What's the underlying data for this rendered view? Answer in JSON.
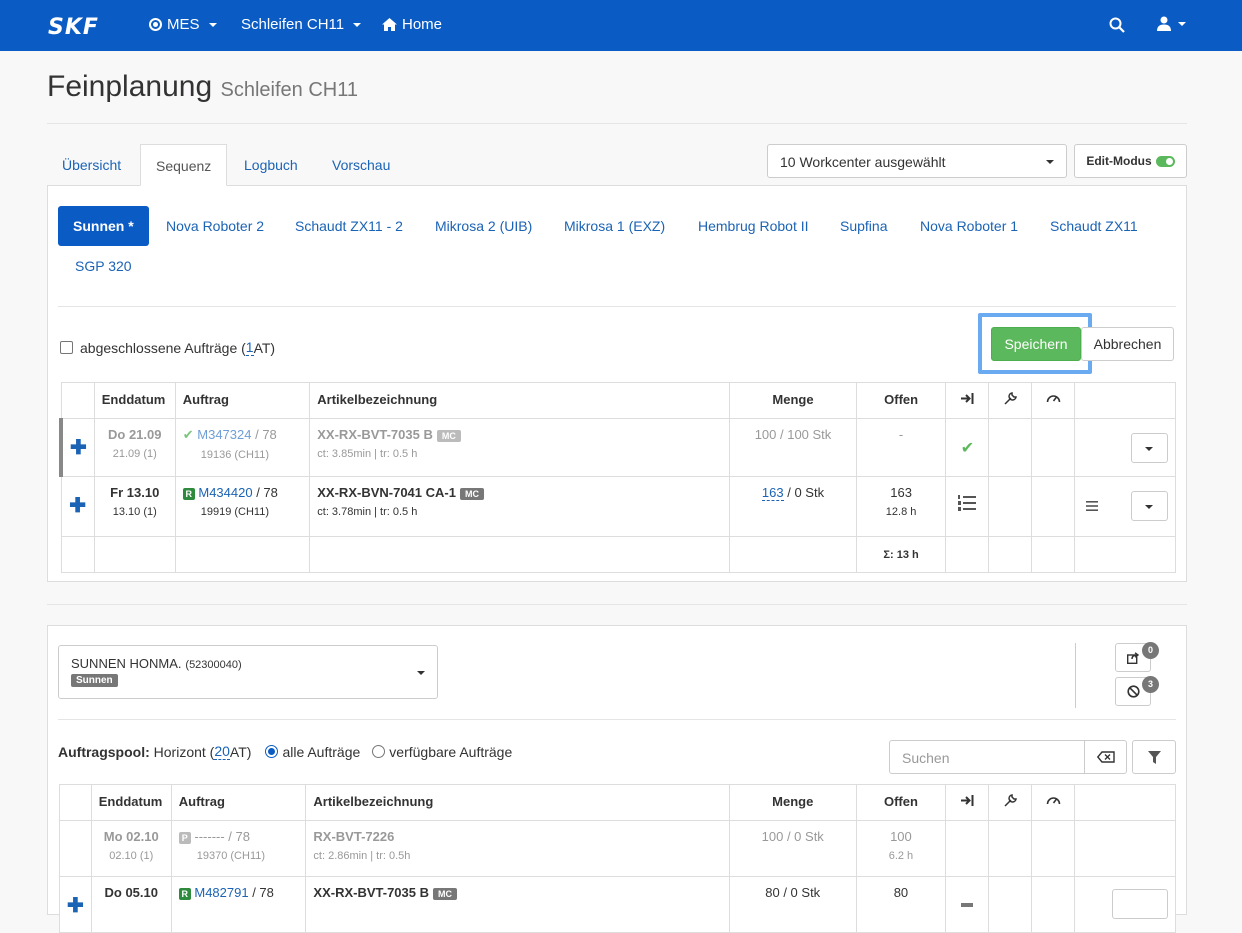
{
  "nav": {
    "logo": "SKF",
    "mes": "MES",
    "area": "Schleifen CH11",
    "home": "Home"
  },
  "page": {
    "title": "Feinplanung",
    "subtitle": "Schleifen CH11"
  },
  "tabs": [
    "Übersicht",
    "Sequenz",
    "Logbuch",
    "Vorschau"
  ],
  "workcenter_select": "10 Workcenter ausgewählt",
  "edit_mode": {
    "label": "Edit-Modus",
    "on": true
  },
  "workcenters": [
    "Sunnen *",
    "Nova Roboter 2",
    "Schaudt ZX11 - 2",
    "Mikrosa 2 (UIB)",
    "Mikrosa 1 (EXZ)",
    "Hembrug Robot II",
    "Supfina",
    "Nova Roboter 1",
    "Schaudt ZX11",
    "SGP 320"
  ],
  "closed_orders": {
    "label": "abgeschlossene Aufträge (",
    "count": "1",
    "suffix": " AT)"
  },
  "buttons": {
    "save": "Speichern",
    "cancel": "Abbrechen"
  },
  "columns": [
    "Enddatum",
    "Auftrag",
    "Artikelbezeichnung",
    "Menge",
    "Offen"
  ],
  "seq_rows": [
    {
      "date": "Do 21.09",
      "date_sub": "21.09 (1)",
      "order": "M347324",
      "order_suffix": " / 78",
      "order_sub": "19136 (CH11)",
      "article": "XX-RX-BVT-7035 B",
      "badge": "MC",
      "article_sub": "ct: 3.85min | tr: 0.5 h",
      "menge": "100 / 100 Stk",
      "offen": "-",
      "offen_sub": ""
    },
    {
      "date": "Fr 13.10",
      "date_sub": "13.10 (1)",
      "order_tag": "R",
      "order": "M434420",
      "order_suffix": " / 78",
      "order_sub": "19919 (CH11)",
      "article": "XX-RX-BVN-7041 CA-1",
      "badge": "MC",
      "article_sub": "ct: 3.78min | tr: 0.5 h",
      "menge_link": "163",
      "menge_rest": " / 0 Stk",
      "offen": "163",
      "offen_sub": "12.8 h"
    }
  ],
  "sum": "Σ: 13 h",
  "machine": {
    "name": "SUNNEN HONMA.",
    "id": "(52300040)",
    "tag": "Sunnen",
    "count_share": "0",
    "count_block": "3"
  },
  "pool": {
    "label": "Auftragspool:",
    "horizon": "Horizont (",
    "horizon_count": "20",
    "horizon_suffix": " AT)",
    "radio_all": "alle Aufträge",
    "radio_avail": "verfügbare Aufträge",
    "search_placeholder": "Suchen"
  },
  "pool_rows": [
    {
      "date": "Mo 02.10",
      "date_sub": "02.10 (1)",
      "order_tag": "P",
      "order": "-------",
      "order_suffix": " / 78",
      "order_sub": "19370 (CH11)",
      "article": "RX-BVT-7226",
      "article_sub": "ct: 2.86min | tr: 0.5h",
      "menge": "100 / 0 Stk",
      "offen": "100",
      "offen_sub": "6.2 h"
    },
    {
      "date": "Do 05.10",
      "order_tag": "R",
      "order": "M482791",
      "order_suffix": " / 78",
      "article": "XX-RX-BVT-7035 B",
      "badge": "MC",
      "menge": "80 / 0 Stk",
      "offen": "80"
    }
  ],
  "colors": {
    "nav": "#0a5cc4",
    "save": "#5cb85c",
    "highlight": "#6aaaf0",
    "link": "#1b63b5"
  }
}
